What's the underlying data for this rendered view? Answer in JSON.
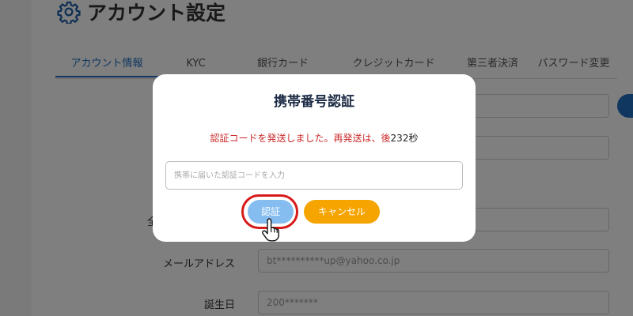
{
  "page": {
    "title": "アカウント設定",
    "tabs": [
      {
        "label": "アカウント情報",
        "active": true
      },
      {
        "label": "KYC"
      },
      {
        "label": "銀行カード"
      },
      {
        "label": "クレジットカード"
      },
      {
        "label": "第三者決済"
      },
      {
        "label": "パスワード変更"
      }
    ],
    "fields": [
      {
        "label": "",
        "value": ""
      },
      {
        "label": "",
        "value": ""
      },
      {
        "label": "全",
        "value": ""
      },
      {
        "label": "メールアドレス",
        "value": "bt**********up@yahoo.co.jp"
      },
      {
        "label": "誕生日",
        "value": "200*******"
      }
    ]
  },
  "modal": {
    "title": "携帯番号認証",
    "message_prefix": "認証コードを発送しました。再発送は、後",
    "countdown": "232秒",
    "input_placeholder": "携帯に届いた認証コードを入力",
    "confirm_label": "認証",
    "cancel_label": "キャンセル"
  },
  "colors": {
    "accent": "#1f6fbf",
    "confirm_button": "#86bdf0",
    "cancel_button": "#f5a400",
    "highlight_ring": "#d71a1a",
    "message": "#cc2b2b"
  },
  "icons": {
    "header": "gear-icon",
    "cursor": "hand-pointer-icon"
  }
}
